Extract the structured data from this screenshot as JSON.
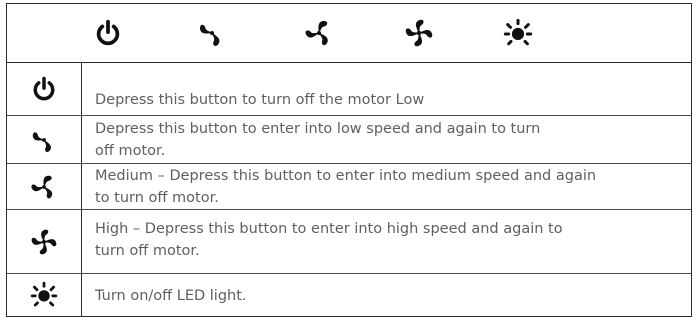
{
  "table": {
    "header_icons": [
      "power-icon",
      "fan-low-icon",
      "fan-medium-icon",
      "fan-high-icon",
      "light-icon"
    ],
    "rows": [
      {
        "icon": "power-icon",
        "description": "Depress this button to turn off the motor Low"
      },
      {
        "icon": "fan-low-icon",
        "description_lines": [
          "Depress this button to enter into low speed and again to turn",
          "off motor."
        ]
      },
      {
        "icon": "fan-medium-icon",
        "description_lines": [
          "Medium – Depress this button to enter into medium speed and again",
          "to turn off motor."
        ]
      },
      {
        "icon": "fan-high-icon",
        "description_lines": [
          "High – Depress this button to enter into high speed and again to",
          "turn off motor."
        ]
      },
      {
        "icon": "light-icon",
        "description": "Turn on/off LED light."
      }
    ]
  }
}
